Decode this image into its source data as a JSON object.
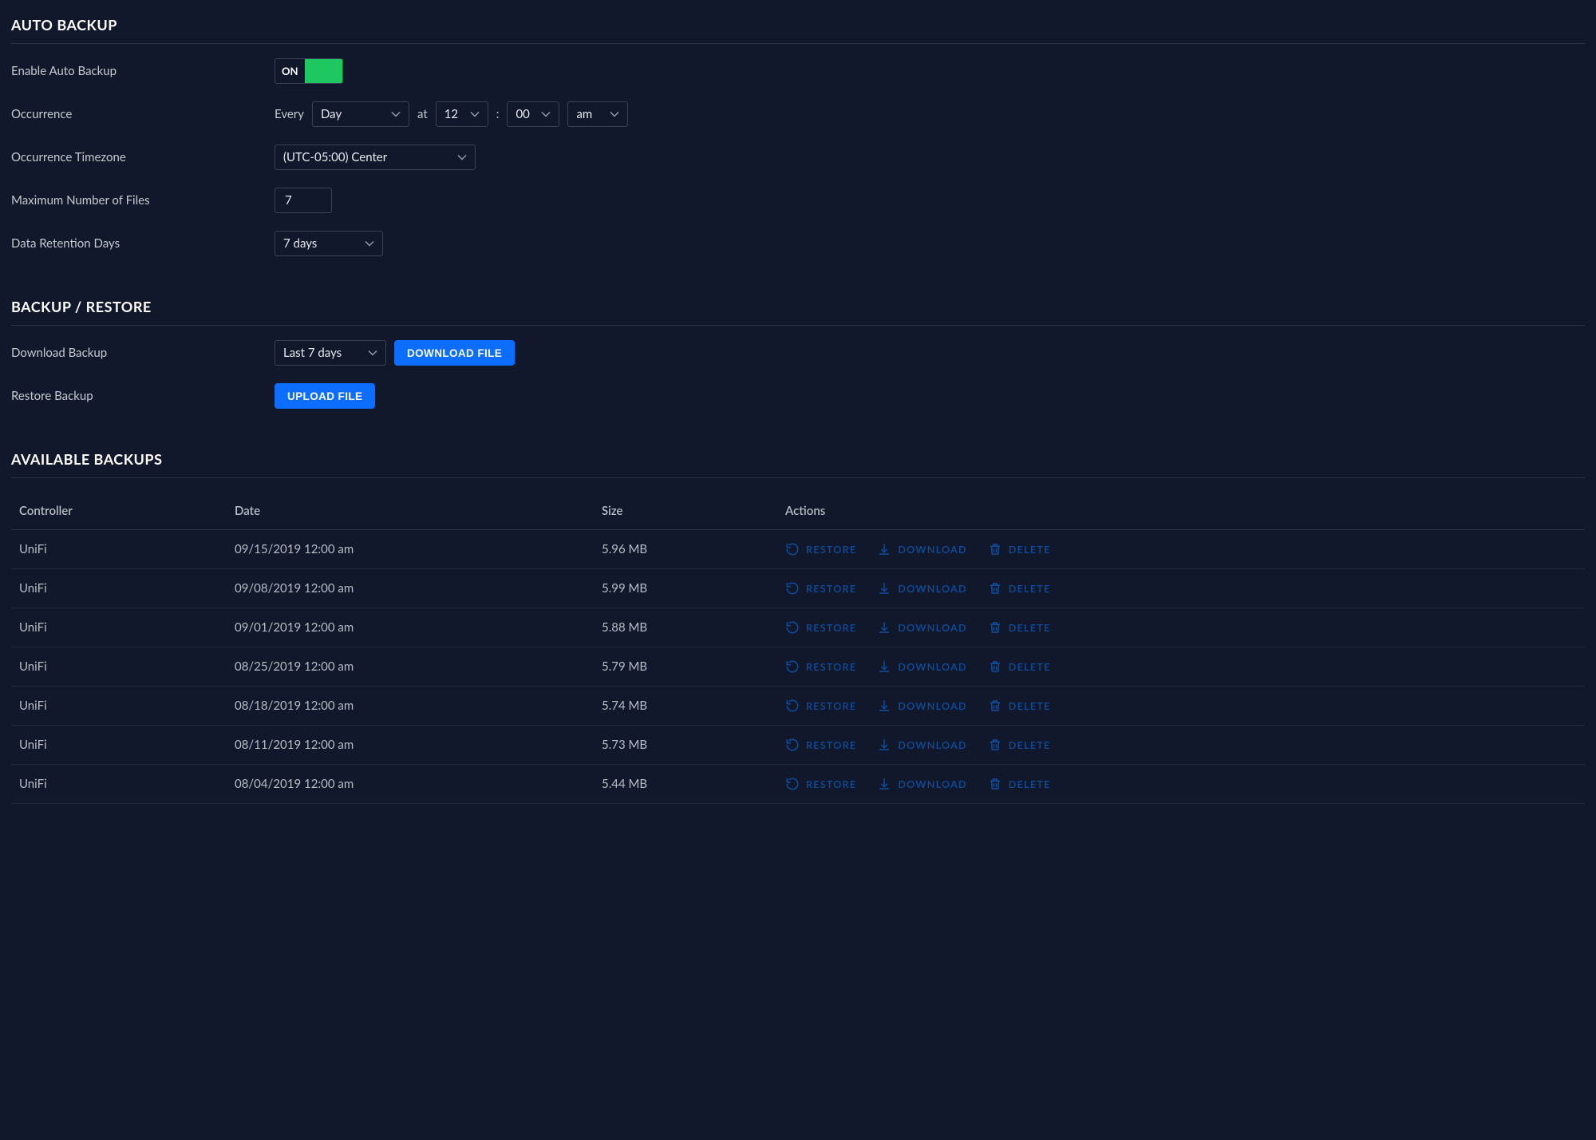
{
  "auto_backup": {
    "title": "AUTO BACKUP",
    "enable_label": "Enable Auto Backup",
    "toggle_text": "ON",
    "occurrence_label": "Occurrence",
    "every_text": "Every",
    "frequency": "Day",
    "at_text": "at",
    "hour": "12",
    "colon": ":",
    "minute": "00",
    "ampm": "am",
    "tz_label": "Occurrence Timezone",
    "tz_value": "(UTC-05:00) Center",
    "max_files_label": "Maximum Number of Files",
    "max_files_value": "7",
    "retention_label": "Data Retention Days",
    "retention_value": "7 days"
  },
  "backup_restore": {
    "title": "BACKUP / RESTORE",
    "download_label": "Download Backup",
    "download_range": "Last 7 days",
    "download_button": "DOWNLOAD FILE",
    "restore_label": "Restore Backup",
    "upload_button": "UPLOAD FILE"
  },
  "available": {
    "title": "AVAILABLE BACKUPS",
    "cols": {
      "controller": "Controller",
      "date": "Date",
      "size": "Size",
      "actions": "Actions"
    },
    "action_labels": {
      "restore": "RESTORE",
      "download": "DOWNLOAD",
      "delete": "DELETE"
    },
    "rows": [
      {
        "controller": "UniFi",
        "date": "09/15/2019 12:00 am",
        "size": "5.96 MB"
      },
      {
        "controller": "UniFi",
        "date": "09/08/2019 12:00 am",
        "size": "5.99 MB"
      },
      {
        "controller": "UniFi",
        "date": "09/01/2019 12:00 am",
        "size": "5.88 MB"
      },
      {
        "controller": "UniFi",
        "date": "08/25/2019 12:00 am",
        "size": "5.79 MB"
      },
      {
        "controller": "UniFi",
        "date": "08/18/2019 12:00 am",
        "size": "5.74 MB"
      },
      {
        "controller": "UniFi",
        "date": "08/11/2019 12:00 am",
        "size": "5.73 MB"
      },
      {
        "controller": "UniFi",
        "date": "08/04/2019 12:00 am",
        "size": "5.44 MB"
      }
    ]
  }
}
